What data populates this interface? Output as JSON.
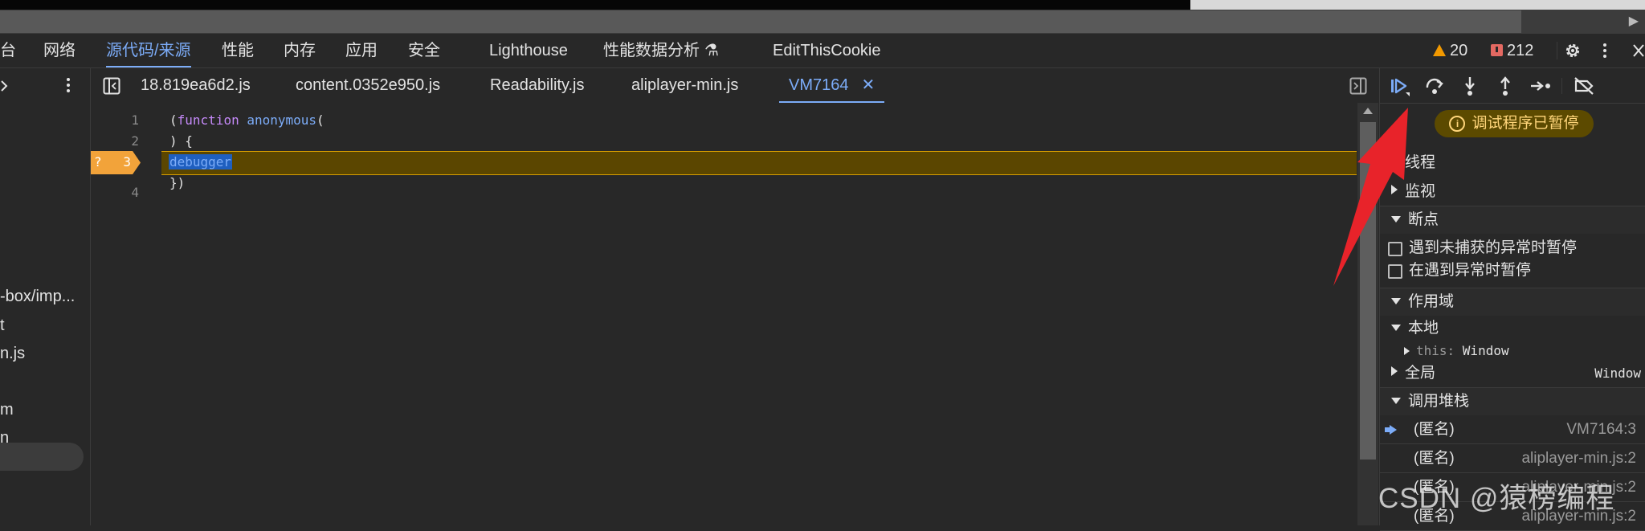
{
  "panel_tabs": [
    "台",
    "网络",
    "源代码/来源",
    "性能",
    "内存",
    "应用",
    "安全",
    "Lighthouse",
    "性能数据分析",
    "EditThisCookie"
  ],
  "active_panel": "源代码/来源",
  "warnings_count": "20",
  "issues_count": "212",
  "file_tabs": [
    "18.819ea6d2.js",
    "content.0352e950.js",
    "Readability.js",
    "aliplayer-min.js",
    "VM7164"
  ],
  "active_file": "VM7164",
  "navigator_items": [
    "-box/imp...",
    "t",
    "n.js",
    "m",
    "n"
  ],
  "code": {
    "line_numbers": [
      "1",
      "2",
      "3",
      "4"
    ],
    "line1_paren": "(",
    "line1_keyword": "function",
    "line1_name": " anonymous",
    "line1_tail": "(",
    "line2": ") {",
    "line3": "debugger",
    "line4": "})",
    "paused_line": "3",
    "breakpoint_marker": "?"
  },
  "debugger": {
    "paused_badge": "调试程序已暂停",
    "sections": {
      "threads": "线程",
      "watch": "监视",
      "breakpoints": "断点",
      "scope": "作用域",
      "call_stack": "调用堆栈"
    },
    "breakpoint_options": [
      "遇到未捕获的异常时暂停",
      "在遇到异常时暂停"
    ],
    "scope": {
      "local_label": "本地",
      "this_key": "this",
      "this_value": "Window",
      "global_label": "全局",
      "global_value": "Window"
    },
    "call_stack": [
      {
        "name": "(匿名)",
        "location": "VM7164:3"
      },
      {
        "name": "(匿名)",
        "location": "aliplayer-min.js:2"
      },
      {
        "name": "(匿名)",
        "location": "aliplayer-min.js:2"
      },
      {
        "name": "(匿名)",
        "location": "aliplayer-min.js:2"
      }
    ]
  },
  "watermark": "CSDN @猿榜编程",
  "colors": {
    "accent": "#7cacf8",
    "paused_line_bg": "#5b4600",
    "breakpoint": "#f2a33a",
    "annotation_arrow": "#e8232a"
  }
}
